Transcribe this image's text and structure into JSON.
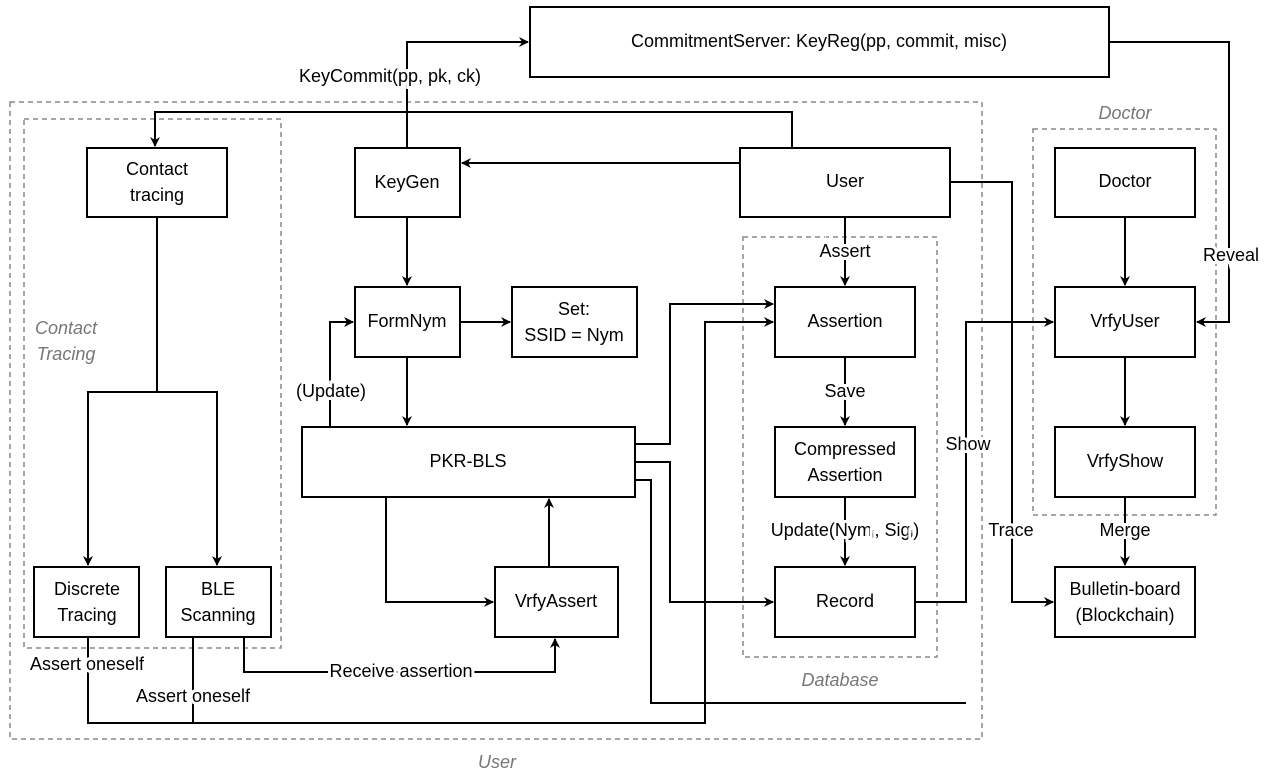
{
  "groups": {
    "user": "User",
    "contact_tracing_1": "Contact",
    "contact_tracing_2": "Tracing",
    "database": "Database",
    "doctor": "Doctor"
  },
  "nodes": {
    "commitment_server": "CommitmentServer: KeyReg(pp, commit, misc)",
    "contact_tracing_1": "Contact",
    "contact_tracing_2": "tracing",
    "keygen": "KeyGen",
    "user": "User",
    "doctor": "Doctor",
    "formnym": "FormNym",
    "set_1": "Set:",
    "set_2": "SSID = Nym",
    "assertion": "Assertion",
    "vrfyuser": "VrfyUser",
    "pkr_bls": "PKR-BLS",
    "compressed_1": "Compressed",
    "compressed_2": "Assertion",
    "vrfyshow": "VrfyShow",
    "discrete_1": "Discrete",
    "discrete_2": "Tracing",
    "ble_1": "BLE",
    "ble_2": "Scanning",
    "vrfyassert": "VrfyAssert",
    "record": "Record",
    "bulletin_1": "Bulletin-board",
    "bulletin_2": "(Blockchain)"
  },
  "edge_labels": {
    "keycommit": "KeyCommit(pp, pk, ck)",
    "assert": "Assert",
    "save": "Save",
    "update_pre": "Update(Nym",
    "update_sub1": "i",
    "update_mid": ", Sig",
    "update_sub2": "i",
    "update_post": ")",
    "update_paren": "(Update)",
    "reveal": "Reveal",
    "show": "Show",
    "trace": "Trace",
    "merge": "Merge",
    "receive": "Receive assertion",
    "assert_oneself_1": "Assert oneself",
    "assert_oneself_2": "Assert oneself"
  }
}
